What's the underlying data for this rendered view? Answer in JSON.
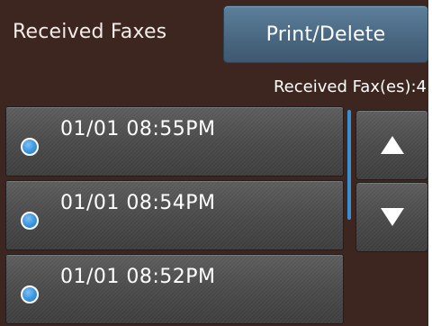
{
  "header": {
    "received_tab_label": "Received Faxes",
    "print_delete_label": "Print/Delete"
  },
  "count_label": "Received Fax(es):4",
  "faxes": [
    {
      "timestamp": "01/01 08:55PM",
      "status_icon": "blue-dot-icon"
    },
    {
      "timestamp": "01/01 08:54PM",
      "status_icon": "blue-dot-icon"
    },
    {
      "timestamp": "01/01 08:52PM",
      "status_icon": "blue-dot-icon"
    }
  ],
  "scroll": {
    "up_icon": "arrow-up-icon",
    "down_icon": "arrow-down-icon"
  },
  "colors": {
    "background": "#3d2620",
    "active_button": "#4a6882",
    "dot": "#3a93de",
    "scrollbar": "#3a8fd0"
  }
}
